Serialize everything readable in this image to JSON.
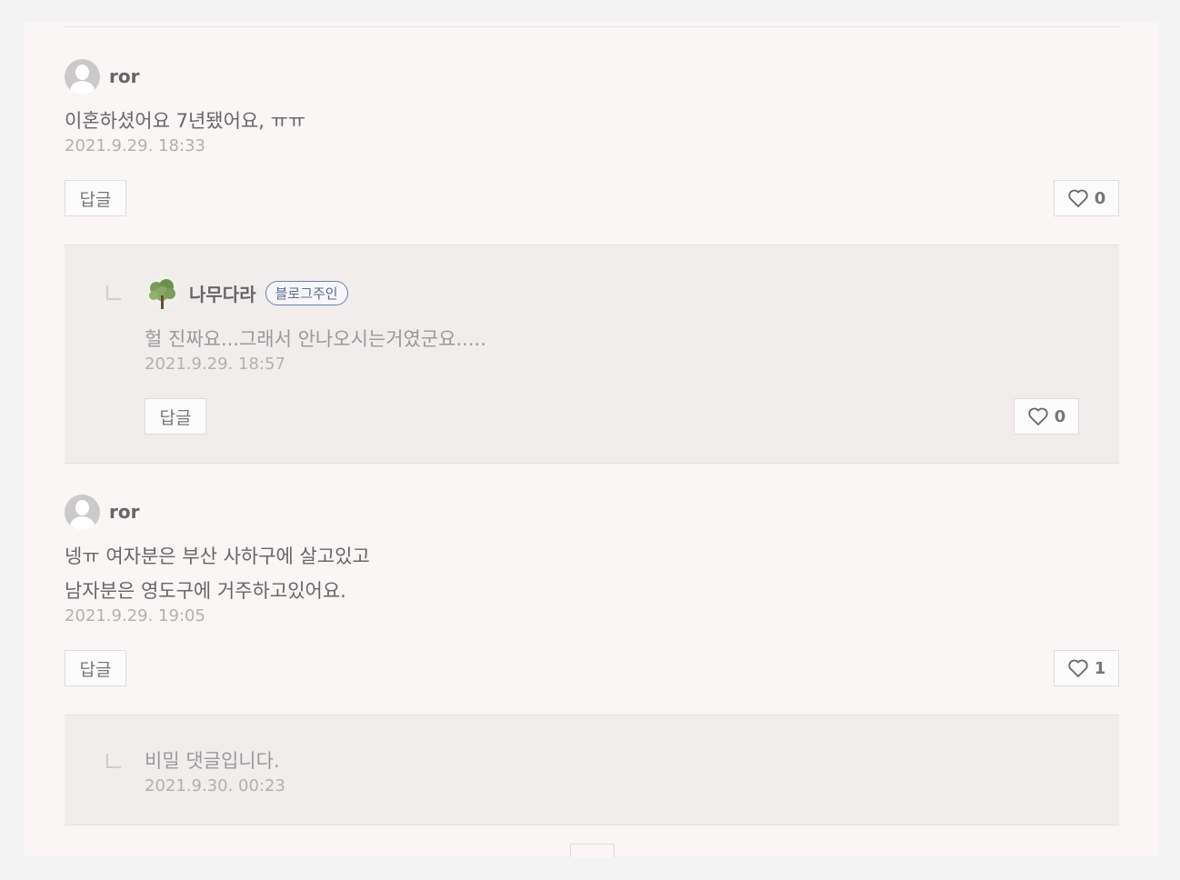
{
  "comments": [
    {
      "author": "ror",
      "text": "이혼하셨어요 7년됐어요, ㅠㅠ",
      "date": "2021.9.29. 18:33",
      "reply_label": "답글",
      "likes": "0",
      "replies": [
        {
          "author": "나무다라",
          "badge": "블로그주인",
          "text": "헐 진짜요...그래서 안나오시는거였군요.....",
          "date": "2021.9.29. 18:57",
          "reply_label": "답글",
          "likes": "0"
        }
      ]
    },
    {
      "author": "ror",
      "text": "넹ㅠ 여자분은 부산 사하구에 살고있고\n남자분은 영도구에 거주하고있어요.",
      "date": "2021.9.29. 19:05",
      "reply_label": "답글",
      "likes": "1",
      "replies": [
        {
          "text": "비밀 댓글입니다.",
          "date": "2021.9.30. 00:23"
        }
      ]
    }
  ],
  "colors": {
    "background": "#f4f3f3",
    "panel": "#faf6f6",
    "reply_area": "#f2eded",
    "badge": "#5b6c96"
  },
  "icons": {
    "avatar": "default-user-avatar-icon",
    "owner_avatar": "tree-avatar-icon",
    "like": "heart-outline-icon",
    "reply_marker": "reply-corner-icon"
  }
}
